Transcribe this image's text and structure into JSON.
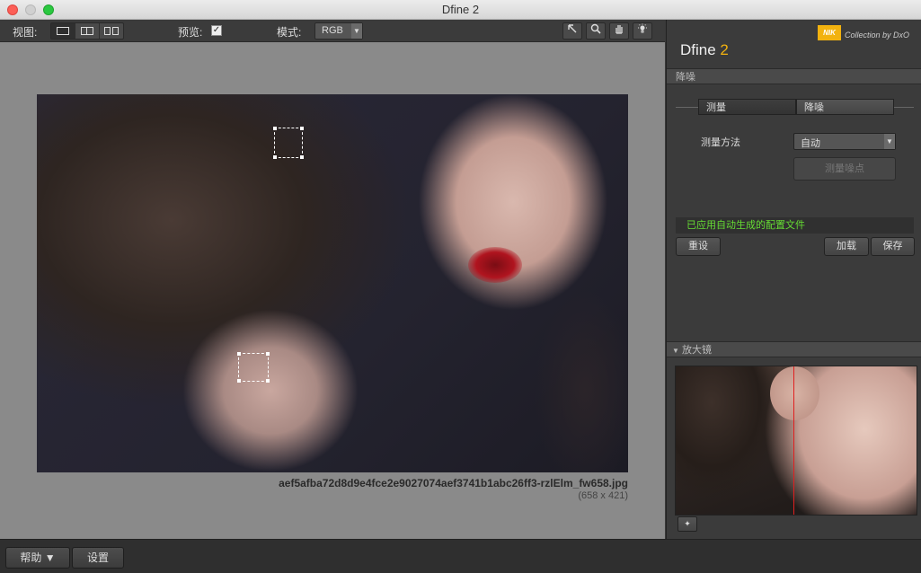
{
  "window": {
    "title": "Dfine 2"
  },
  "toolbar": {
    "view_label": "视图:",
    "preview_label": "预览:",
    "preview_checked": "✓",
    "mode_label": "模式:",
    "mode_value": "RGB",
    "tools": [
      "arrow-tool-icon",
      "zoom-tool-icon",
      "hand-tool-icon",
      "light-tool-icon"
    ]
  },
  "image": {
    "filename": "aef5afba72d8d9e4fce2e9027074aef3741b1abc26ff3-rzlElm_fw658.jpg",
    "dimensions": "(658 x 421)"
  },
  "panel": {
    "brand_collection": "Collection by DxO",
    "brand_logo": "NIK",
    "title_name": "Dfine",
    "title_version": "2",
    "noise_section": "降噪",
    "tabs": [
      "测量",
      "降噪"
    ],
    "measure_method_label": "测量方法",
    "measure_method_value": "自动",
    "measure_points_button": "测量噪点",
    "status_text": "已应用自动生成的配置文件",
    "reset_button": "重设",
    "load_button": "加载",
    "save_button": "保存",
    "loupe_section": "放大镜"
  },
  "bottom": {
    "help_button": "帮助 ▼",
    "settings_button": "设置"
  },
  "colors": {
    "accent": "#f2b20f",
    "status_green": "#66dd33",
    "loupe_line": "#e02020"
  }
}
